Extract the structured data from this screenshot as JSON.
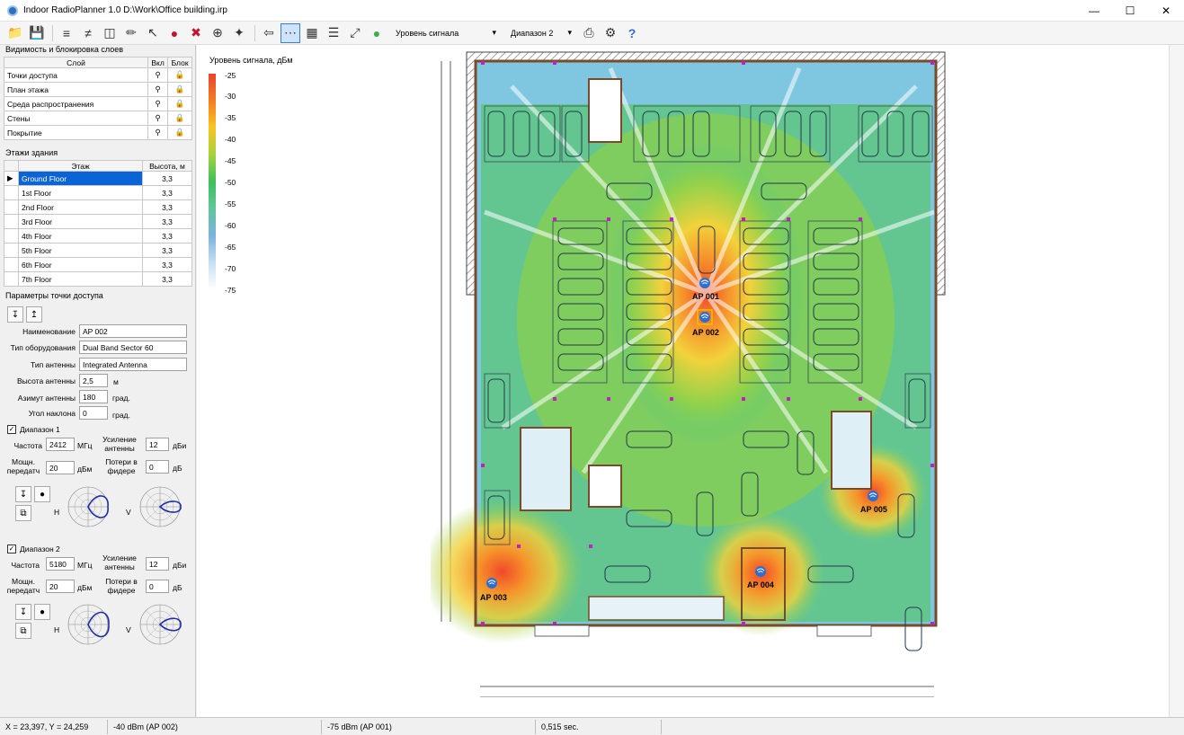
{
  "window": {
    "title": "Indoor RadioPlanner 1.0 D:\\Work\\Office building.irp"
  },
  "toolbar": {
    "signal_dropdown": "Уровень сигнала",
    "band_dropdown": "Диапазон 2"
  },
  "layers": {
    "title": "Видимость и блокировка слоев",
    "col_layer": "Слой",
    "col_on": "Вкл",
    "col_lock": "Блок",
    "rows": [
      {
        "name": "Точки доступа"
      },
      {
        "name": "План этажа"
      },
      {
        "name": "Среда распространения"
      },
      {
        "name": "Стены"
      },
      {
        "name": "Покрытие"
      }
    ]
  },
  "floors": {
    "title": "Этажи здания",
    "col_floor": "Этаж",
    "col_height": "Высота, м",
    "rows": [
      {
        "name": "Ground Floor",
        "height": "3,3"
      },
      {
        "name": "1st Floor",
        "height": "3,3"
      },
      {
        "name": "2nd Floor",
        "height": "3,3"
      },
      {
        "name": "3rd Floor",
        "height": "3,3"
      },
      {
        "name": "4th Floor",
        "height": "3,3"
      },
      {
        "name": "5th Floor",
        "height": "3,3"
      },
      {
        "name": "6th Floor",
        "height": "3,3"
      },
      {
        "name": "7th Floor",
        "height": "3,3"
      }
    ]
  },
  "ap_params": {
    "title": "Параметры точки доступа",
    "name_label": "Наименование",
    "name": "AP 002",
    "equip_label": "Тип оборудования",
    "equip": "Dual Band Sector 60",
    "antenna_label": "Тип антенны",
    "antenna": "Integrated Antenna",
    "height_label": "Высота антенны",
    "height": "2,5",
    "height_unit": "м",
    "azimuth_label": "Азимут антенны",
    "azimuth": "180",
    "azimuth_unit": "град.",
    "tilt_label": "Угол наклона",
    "tilt": "0",
    "tilt_unit": "град.",
    "band1": {
      "title": "Диапазон 1",
      "freq_label": "Частота",
      "freq": "2412",
      "freq_unit": "МГц",
      "gain_label": "Усиление антенны",
      "gain": "12",
      "gain_unit": "дБи",
      "power_label": "Мощн. передатч",
      "power": "20",
      "power_unit": "дБм",
      "loss_label": "Потери в фидере",
      "loss": "0",
      "loss_unit": "дБ",
      "h": "H",
      "v": "V"
    },
    "band2": {
      "title": "Диапазон 2",
      "freq_label": "Частота",
      "freq": "5180",
      "freq_unit": "МГц",
      "gain_label": "Усиление антенны",
      "gain": "12",
      "gain_unit": "дБи",
      "power_label": "Мощн. передатч",
      "power": "20",
      "power_unit": "дБм",
      "loss_label": "Потери в фидере",
      "loss": "0",
      "loss_unit": "дБ",
      "h": "H",
      "v": "V"
    }
  },
  "legend": {
    "title": "Уровень сигнала, дБм",
    "levels": [
      "-25",
      "-30",
      "-35",
      "-40",
      "-45",
      "-50",
      "-55",
      "-60",
      "-65",
      "-70",
      "-75"
    ]
  },
  "access_points": [
    {
      "label": "AP 001"
    },
    {
      "label": "AP 002"
    },
    {
      "label": "AP 003"
    },
    {
      "label": "AP 004"
    },
    {
      "label": "AP 005"
    }
  ],
  "status": {
    "coords": "X = 23,397, Y = 24,259",
    "best": "-40 dBm (AP 002)",
    "second": "-75 dBm (AP 001)",
    "time": "0,515 sec."
  }
}
